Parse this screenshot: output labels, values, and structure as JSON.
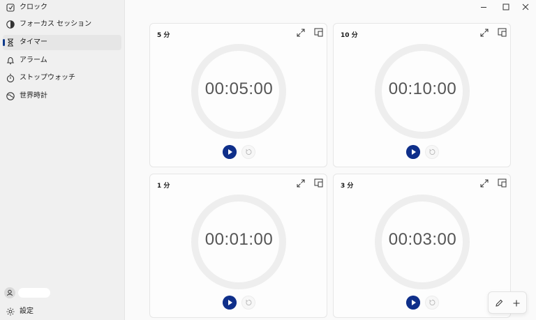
{
  "sidebar": {
    "items": [
      {
        "label": "クロック",
        "icon": "clock-icon",
        "active": false
      },
      {
        "label": "フォーカス セッション",
        "icon": "focus-icon",
        "active": false
      },
      {
        "label": "タイマー",
        "icon": "hourglass-icon",
        "active": true
      },
      {
        "label": "アラーム",
        "icon": "bell-icon",
        "active": false
      },
      {
        "label": "ストップウォッチ",
        "icon": "stopwatch-icon",
        "active": false
      },
      {
        "label": "世界時計",
        "icon": "globe-icon",
        "active": false
      }
    ],
    "account_icon": "person-icon",
    "settings_label": "設定",
    "settings_icon": "gear-icon"
  },
  "window": {
    "controls": [
      "minimize-icon",
      "maximize-icon",
      "close-icon"
    ]
  },
  "timers": [
    {
      "title": "5 分",
      "time": "00:05:00"
    },
    {
      "title": "10 分",
      "time": "00:10:00"
    },
    {
      "title": "1 分",
      "time": "00:01:00"
    },
    {
      "title": "3 分",
      "time": "00:03:00"
    }
  ],
  "toolbar": {
    "edit_icon": "pencil-icon",
    "add_icon": "plus-icon"
  },
  "colors": {
    "accent": "#0f2f8a",
    "ring": "#eeeeee",
    "sidebar_bg": "#f0f0f0"
  }
}
